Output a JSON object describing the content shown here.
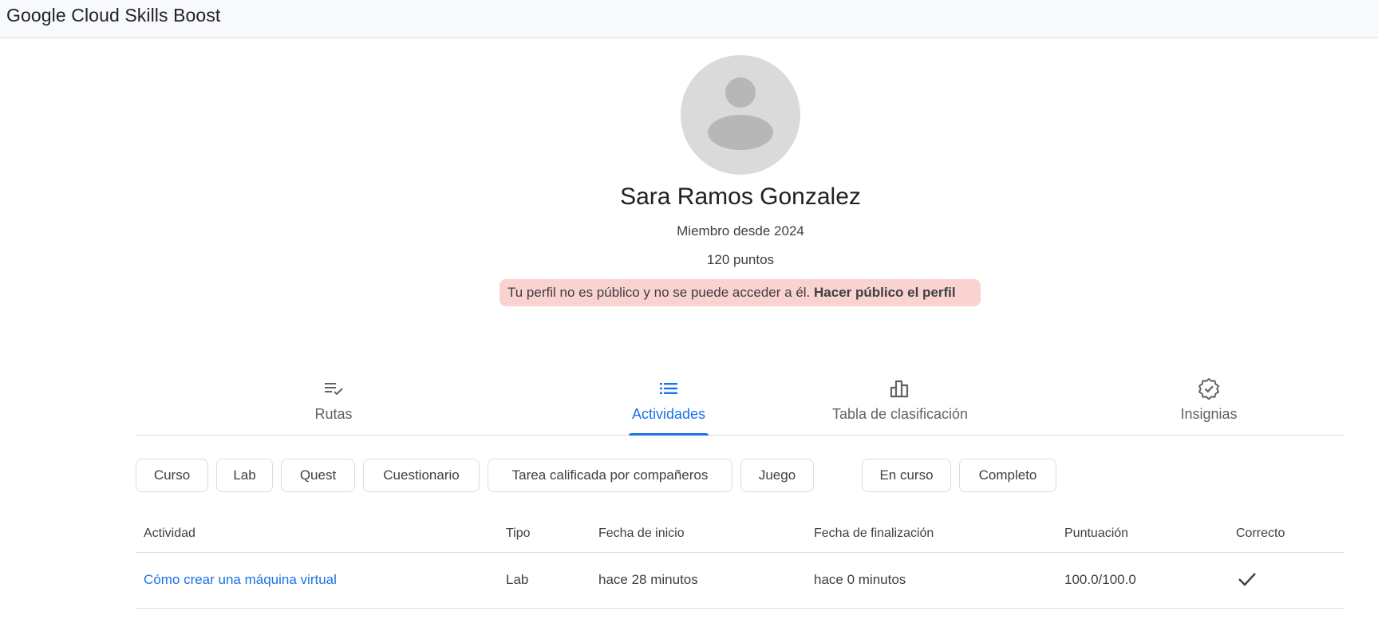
{
  "header": {
    "brand": "Google Cloud Skills Boost"
  },
  "profile": {
    "avatar_icon": "person-avatar-icon",
    "name": "Sara Ramos Gonzalez",
    "member_since": "Miembro desde 2024",
    "points": "120 puntos",
    "notice_text": "Tu perfil no es público y no se puede acceder a él.",
    "make_public_label": "Hacer público el perfil",
    "notice_color": "#fad2cf"
  },
  "tabs": [
    {
      "label": "Rutas",
      "icon": "playlist-check-icon",
      "active": false
    },
    {
      "label": "Actividades",
      "icon": "list-icon",
      "active": true
    },
    {
      "label": "Tabla de clasificación",
      "icon": "leaderboard-icon",
      "active": false
    },
    {
      "label": "Insignias",
      "icon": "verified-badge-icon",
      "active": false
    }
  ],
  "filters": {
    "type": [
      "Curso",
      "Lab",
      "Quest",
      "Cuestionario",
      "Tarea calificada por compañeros",
      "Juego"
    ],
    "status": [
      "En curso",
      "Completo"
    ]
  },
  "table": {
    "headers": [
      "Actividad",
      "Tipo",
      "Fecha de inicio",
      "Fecha de finalización",
      "Puntuación",
      "Correcto"
    ],
    "rows": [
      {
        "activity": "Cómo crear una máquina virtual",
        "type": "Lab",
        "start": "hace 28 minutos",
        "end": "hace 0 minutos",
        "score": "100.0/100.0",
        "passed_icon": "check-icon"
      }
    ]
  },
  "colors": {
    "accent": "#1a73e8",
    "text": "#3c4043",
    "muted": "#5f6368"
  }
}
